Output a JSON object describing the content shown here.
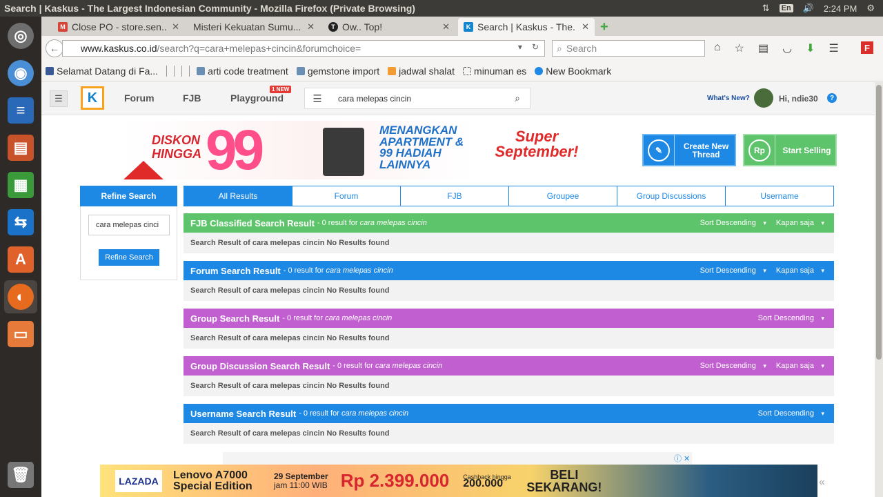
{
  "os": {
    "window_title": "Search | Kaskus - The Largest Indonesian Community - Mozilla Firefox (Private Browsing)",
    "lang": "En",
    "time": "2:24 PM"
  },
  "tabs": [
    {
      "label": "Close PO - store.sen..."
    },
    {
      "label": "Misteri Kekuatan Sumu..."
    },
    {
      "label": "Ow.. Top!"
    },
    {
      "label": "Search | Kaskus - The..."
    }
  ],
  "nav": {
    "url_host": "www.kaskus.co.id",
    "url_path": "/search?q=cara+melepas+cincin&forumchoice=",
    "search_placeholder": "Search"
  },
  "bookmarks": [
    {
      "label": "Selamat Datang di Fa..."
    },
    {
      "label": "arti code treatment"
    },
    {
      "label": "gemstone import"
    },
    {
      "label": "jadwal shalat"
    },
    {
      "label": "minuman es"
    },
    {
      "label": "New Bookmark"
    }
  ],
  "site": {
    "nav": {
      "forum": "Forum",
      "fjb": "FJB",
      "playground": "Playground",
      "new_badge": "1 NEW"
    },
    "search_value": "cara melepas cincin",
    "whats_new": "What's New?",
    "greeting": "Hi, ndie30"
  },
  "banner": {
    "diskon": "DISKON HINGGA",
    "big": "99",
    "prizes": "MENANGKAN APARTMENT & 99 HADIAH LAINNYA",
    "mall": "Super September!"
  },
  "buttons": {
    "create": "Create New Thread",
    "sell": "Start Selling"
  },
  "refine": {
    "title": "Refine Search",
    "input": "cara melepas cinci",
    "button": "Refine Search"
  },
  "search_tabs": [
    "All Results",
    "Forum",
    "FJB",
    "Groupee",
    "Group Discussions",
    "Username"
  ],
  "results": [
    {
      "title": "FJB Classified Search Result",
      "meta": "- 0 result for",
      "query": "cara melepas cincin",
      "sort": "Sort Descending",
      "time": "Kapan saja",
      "body": "Search Result of cara melepas cincin No Results found",
      "color": "#5ec46b"
    },
    {
      "title": "Forum Search Result",
      "meta": "- 0 result for",
      "query": "cara melepas cincin",
      "sort": "Sort Descending",
      "time": "Kapan saja",
      "body": "Search Result of cara melepas cincin No Results found",
      "color": "#1e88e5"
    },
    {
      "title": "Group Search Result",
      "meta": "- 0 result for",
      "query": "cara melepas cincin",
      "sort": "Sort Descending",
      "time": "",
      "body": "Search Result of cara melepas cincin No Results found",
      "color": "#c15fd0"
    },
    {
      "title": "Group Discussion Search Result",
      "meta": "- 0 result for",
      "query": "cara melepas cincin",
      "sort": "Sort Descending",
      "time": "Kapan saja",
      "body": "Search Result of cara melepas cincin No Results found",
      "color": "#c15fd0"
    },
    {
      "title": "Username Search Result",
      "meta": "- 0 result for",
      "query": "cara melepas cincin",
      "sort": "Sort Descending",
      "time": "",
      "body": "Search Result of cara melepas cincin No Results found",
      "color": "#1e88e5"
    }
  ],
  "ad": {
    "brand": "LAZADA",
    "product": "Lenovo A7000 Special Edition",
    "date": "29 September",
    "hour": "jam 11:00 WIB",
    "price": "Rp 2.399.000",
    "cashback_label": "Cashback hingga",
    "cashback": "200.000",
    "cta": "BELI SEKARANG!"
  }
}
